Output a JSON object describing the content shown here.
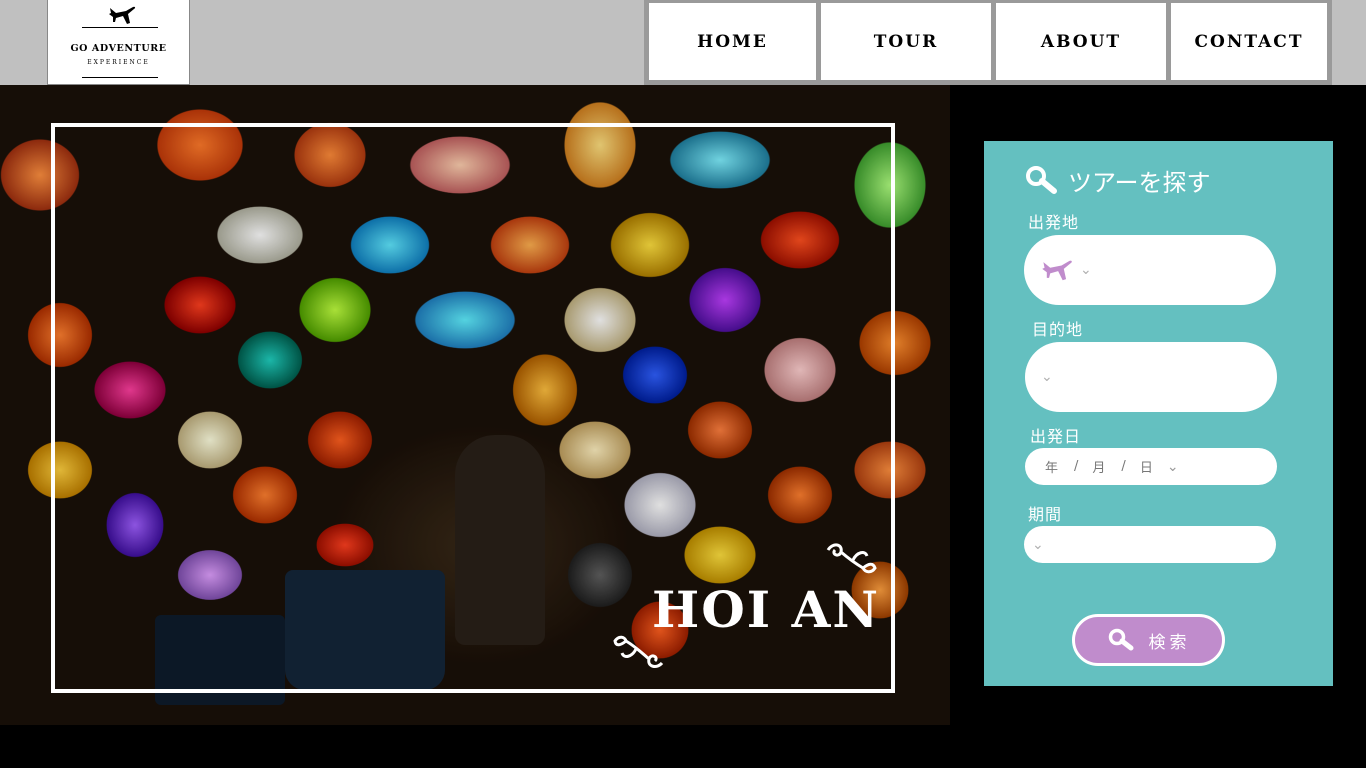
{
  "logo": {
    "title": "GO ADVENTURE",
    "subtitle": "EXPERIENCE"
  },
  "nav": {
    "items": [
      "HOME",
      "TOUR",
      "ABOUT",
      "CONTACT"
    ]
  },
  "hero": {
    "city": "HOI AN"
  },
  "search": {
    "title": "ツアーを探す",
    "departure_label": "出発地",
    "destination_label": "目的地",
    "date_label": "出発日",
    "date_year": "年",
    "date_month": "月",
    "date_day": "日",
    "date_sep": "/",
    "duration_label": "期間",
    "button_label": "検索"
  },
  "colors": {
    "panel": "#64c0c0",
    "accent": "#c08ccc",
    "header": "#c0c0c0"
  },
  "icons": [
    "airplane-icon",
    "search-icon",
    "chevron-down-icon",
    "flourish-ornament-icon"
  ]
}
